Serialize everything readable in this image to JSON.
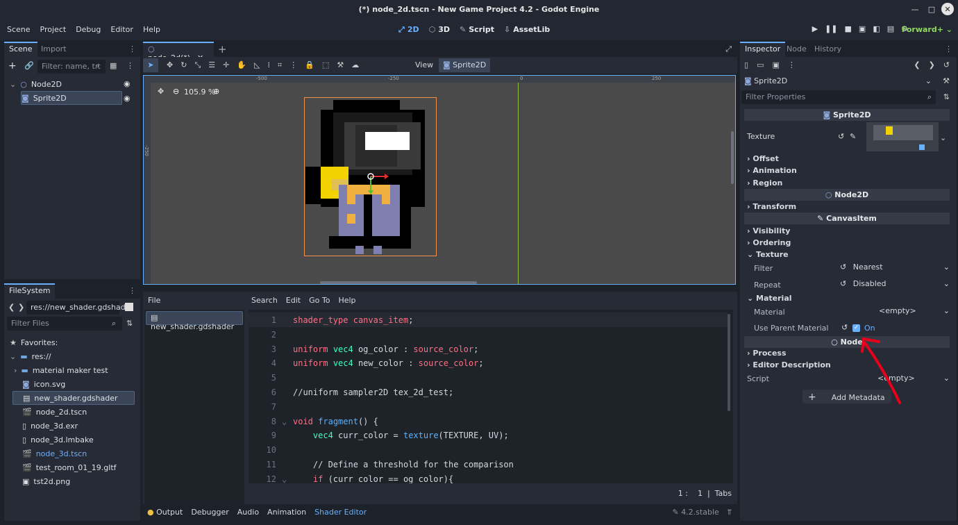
{
  "window": {
    "title": "(*) node_2d.tscn - New Game Project 4.2 - Godot Engine"
  },
  "menu": [
    "Scene",
    "Project",
    "Debug",
    "Editor",
    "Help"
  ],
  "workspaces": [
    "2D",
    "3D",
    "Script",
    "AssetLib"
  ],
  "renderer": "Forward+",
  "scene_dock": {
    "tabs": [
      "Scene",
      "Import"
    ],
    "filter_placeholder": "Filter: name, t:t",
    "nodes": [
      "Node2D",
      "Sprite2D"
    ]
  },
  "filesystem": {
    "tab": "FileSystem",
    "path": "res://new_shader.gdshader",
    "filter_placeholder": "Filter Files",
    "favorites": "Favorites:",
    "root": "res://",
    "items": [
      "material maker test",
      "icon.svg",
      "new_shader.gdshader",
      "node_2d.tscn",
      "node_3d.exr",
      "node_3d.lmbake",
      "node_3d.tscn",
      "test_room_01_19.gltf",
      "tst2d.png"
    ]
  },
  "editor_tab": "node_2d(*)",
  "toolbar": {
    "view": "View",
    "node": "Sprite2D"
  },
  "zoom": "105.9 %",
  "rulers": [
    "-500",
    "-250",
    "0",
    "250",
    "-250"
  ],
  "shader_editor": {
    "file_menu": "File",
    "menus": [
      "Search",
      "Edit",
      "Go To",
      "Help"
    ],
    "file": "new_shader.gdshader",
    "line_numbers": [
      "1",
      "2",
      "3",
      "4",
      "5",
      "6",
      "7",
      "8",
      "9",
      "10",
      "11",
      "12"
    ],
    "lines": [
      "shader_type canvas_item;",
      "",
      "uniform vec4 og_color : source_color;",
      "uniform vec4 new_color : source_color;",
      "",
      "//uniform sampler2D tex_2d_test;",
      "",
      "void fragment() {",
      "    vec4 curr_color = texture(TEXTURE, UV);",
      "",
      "    // Define a threshold for the comparison",
      "    if (curr_color == og_color){"
    ],
    "cursor": "1 :    1  |  Tabs"
  },
  "bottom_panel": [
    "Output",
    "Debugger",
    "Audio",
    "Animation",
    "Shader Editor"
  ],
  "version": "4.2.stable",
  "inspector": {
    "tabs": [
      "Inspector",
      "Node",
      "History"
    ],
    "object": "Sprite2D",
    "filter_placeholder": "Filter Properties",
    "sections": {
      "sprite": "Sprite2D",
      "texture_label": "Texture",
      "offset": "Offset",
      "animation": "Animation",
      "region": "Region",
      "node2d": "Node2D",
      "transform": "Transform",
      "canvasitem": "CanvasItem",
      "visibility": "Visibility",
      "ordering": "Ordering",
      "texture_cat": "Texture",
      "filter_label": "Filter",
      "filter_value": "Nearest",
      "repeat_label": "Repeat",
      "repeat_value": "Disabled",
      "material_cat": "Material",
      "material_label": "Material",
      "material_value": "<empty>",
      "use_parent_label": "Use Parent Material",
      "use_parent_value": "On",
      "node": "Node",
      "process": "Process",
      "editor_desc": "Editor Description",
      "script_label": "Script",
      "script_value": "<empty>",
      "add_metadata": "Add Metadata"
    }
  },
  "colors": {
    "accent": "#6ab0ff",
    "annotation": "#e8001c",
    "sprite_yellow": "#f2d200",
    "sprite_purple": "#8080b0",
    "sprite_orange": "#f0b040"
  }
}
